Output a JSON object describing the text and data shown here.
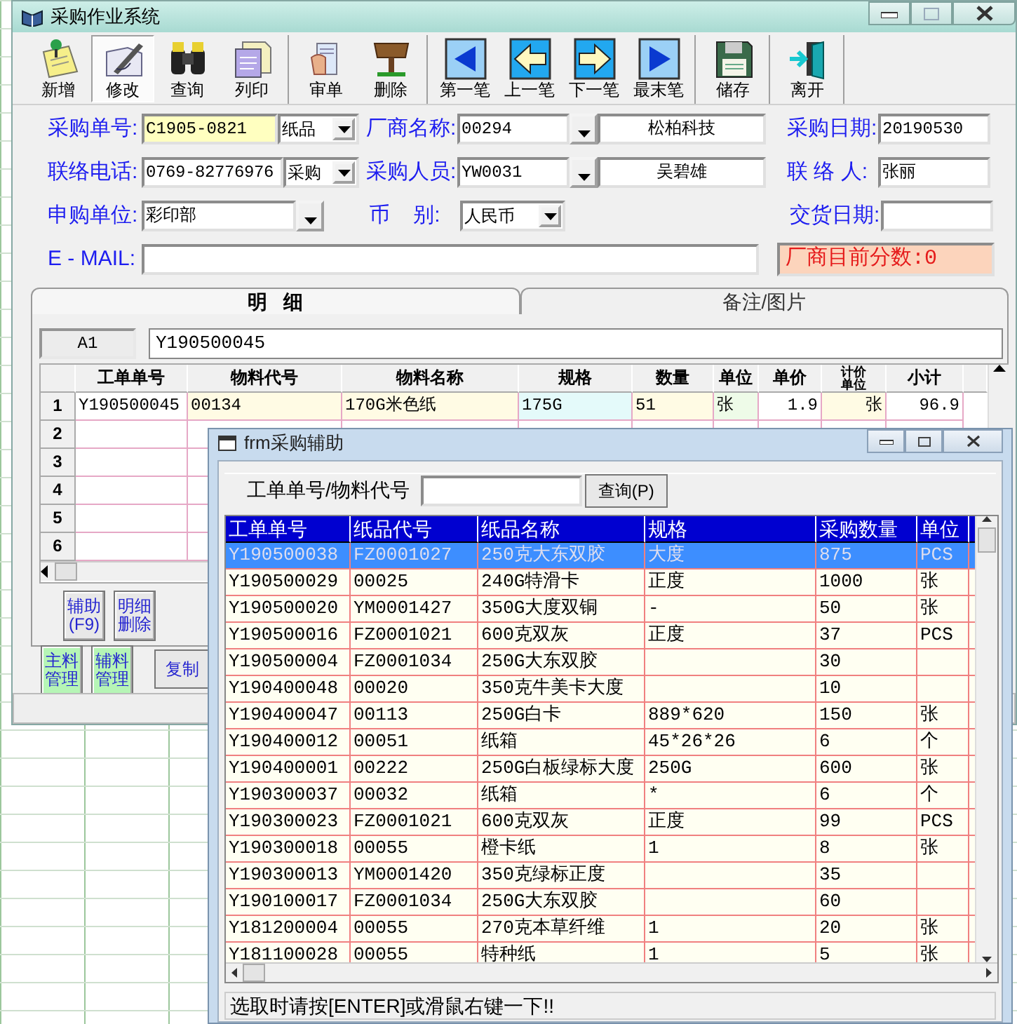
{
  "window": {
    "title": "采购作业系统"
  },
  "toolbar": [
    {
      "buttons": [
        {
          "kind": "new",
          "label": "新增",
          "selected": false
        },
        {
          "kind": "edit",
          "label": "修改",
          "selected": true
        },
        {
          "kind": "query",
          "label": "查询",
          "selected": false
        },
        {
          "kind": "print",
          "label": "列印",
          "selected": false
        }
      ]
    },
    {
      "buttons": [
        {
          "kind": "audit",
          "label": "审单",
          "selected": false
        },
        {
          "kind": "delete",
          "label": "删除",
          "selected": false
        }
      ]
    },
    {
      "buttons": [
        {
          "kind": "first",
          "label": "第一笔",
          "selected": false
        },
        {
          "kind": "prev",
          "label": "上一笔",
          "selected": false
        },
        {
          "kind": "next",
          "label": "下一笔",
          "selected": false
        },
        {
          "kind": "last",
          "label": "最末笔",
          "selected": false
        }
      ]
    },
    {
      "buttons": [
        {
          "kind": "save",
          "label": "储存",
          "selected": false
        }
      ]
    },
    {
      "buttons": [
        {
          "kind": "exit",
          "label": "离开",
          "selected": false
        }
      ]
    }
  ],
  "form": {
    "order_no": {
      "label": "采购单号:",
      "value": "C1905-0821",
      "focused": true
    },
    "order_type": {
      "value": "纸品"
    },
    "vendor": {
      "label": "厂商名称:",
      "code": "00294",
      "name": "松柏科技"
    },
    "purchase_date": {
      "label": "采购日期:",
      "value": "20190530"
    },
    "phone": {
      "label": "联络电话:",
      "value": "0769-82776976",
      "focused": false
    },
    "phone_type": {
      "value": "采购"
    },
    "buyer": {
      "label": "采购人员:",
      "code": "YW0031",
      "name": "吴碧雄"
    },
    "contact": {
      "label": "联 络 人:",
      "value": "张丽"
    },
    "department": {
      "label": "申购单位:",
      "value": "彩印部"
    },
    "currency": {
      "label": "币    别:",
      "value": "人民币"
    },
    "delivery_date": {
      "label": "交货日期:"
    },
    "email": {
      "label": "E - MAIL:"
    },
    "vendor_score": "厂商目前分数:0"
  },
  "tabs": [
    {
      "label": "明   细",
      "selected": true
    },
    {
      "label": "备注/图片",
      "selected": false
    }
  ],
  "detail": {
    "cell_ref": "A1",
    "cell_value": "Y190500045",
    "columns": [
      "工单单号",
      "物料代号",
      "物料名称",
      "规格",
      "数量",
      "单位",
      "单价",
      "计价单位",
      "小计"
    ],
    "rows": [
      {
        "row_number": "1",
        "cells": [
          "Y190500045",
          "00134",
          "170G米色纸",
          "175G",
          "51",
          "张",
          "1.9",
          "张",
          "96.9"
        ]
      },
      {
        "row_number": "2"
      },
      {
        "row_number": "3"
      },
      {
        "row_number": "4"
      },
      {
        "row_number": "5"
      },
      {
        "row_number": "6"
      }
    ],
    "buttons": [
      "辅助(F9)",
      "明细删除"
    ]
  },
  "bottom_buttons": [
    {
      "kind": "green",
      "label": "主料管理"
    },
    {
      "kind": "green",
      "label": "辅料管理"
    },
    {
      "kind": "plain",
      "label": "复制"
    }
  ],
  "dialog": {
    "title": "frm采购辅助",
    "search_label": "工单单号/物料代号",
    "search_button": "查询(P)",
    "columns": [
      "工单单号",
      "纸品代号",
      "纸品名称",
      "规格",
      "采购数量",
      "单位"
    ],
    "rows": [
      {
        "selected": true,
        "cells": [
          "Y190500038",
          "FZ0001027",
          "250克大东双胶",
          "大度",
          "875",
          "PCS"
        ]
      },
      {
        "selected": false,
        "cells": [
          "Y190500029",
          "00025",
          "240G特滑卡",
          "正度",
          "1000",
          "张"
        ]
      },
      {
        "selected": false,
        "cells": [
          "Y190500020",
          "YM0001427",
          "350G大度双铜",
          "-",
          "50",
          "张"
        ]
      },
      {
        "selected": false,
        "cells": [
          "Y190500016",
          "FZ0001021",
          "600克双灰",
          "正度",
          "37",
          "PCS"
        ]
      },
      {
        "selected": false,
        "cells": [
          "Y190500004",
          "FZ0001034",
          "250G大东双胶",
          null,
          "30",
          null
        ]
      },
      {
        "selected": false,
        "cells": [
          "Y190400048",
          "00020",
          "350克牛美卡大度",
          null,
          "10",
          null
        ]
      },
      {
        "selected": false,
        "cells": [
          "Y190400047",
          "00113",
          "250G白卡",
          "889*620",
          "150",
          "张"
        ]
      },
      {
        "selected": false,
        "cells": [
          "Y190400012",
          "00051",
          "纸箱",
          "45*26*26",
          "6",
          "个"
        ]
      },
      {
        "selected": false,
        "cells": [
          "Y190400001",
          "00222",
          "250G白板绿标大度",
          "250G",
          "600",
          "张"
        ]
      },
      {
        "selected": false,
        "cells": [
          "Y190300037",
          "00032",
          "纸箱",
          "*",
          "6",
          "个"
        ]
      },
      {
        "selected": false,
        "cells": [
          "Y190300023",
          "FZ0001021",
          "600克双灰",
          "正度",
          "99",
          "PCS"
        ]
      },
      {
        "selected": false,
        "cells": [
          "Y190300018",
          "00055",
          "橙卡纸",
          "1",
          "8",
          "张"
        ]
      },
      {
        "selected": false,
        "cells": [
          "Y190300013",
          "YM0001420",
          "350克绿标正度",
          null,
          "35",
          null
        ]
      },
      {
        "selected": false,
        "cells": [
          "Y190100017",
          "FZ0001034",
          "250G大东双胶",
          null,
          "60",
          null
        ]
      },
      {
        "selected": false,
        "cells": [
          "Y181200004",
          "00055",
          "270克本草纤维",
          "1",
          "20",
          "张"
        ]
      },
      {
        "selected": false,
        "cells": [
          "Y181100028",
          "00055",
          "特种纸",
          "1",
          "5",
          "张"
        ]
      }
    ],
    "status": "选取时请按[ENTER]或滑鼠右键一下!!"
  }
}
